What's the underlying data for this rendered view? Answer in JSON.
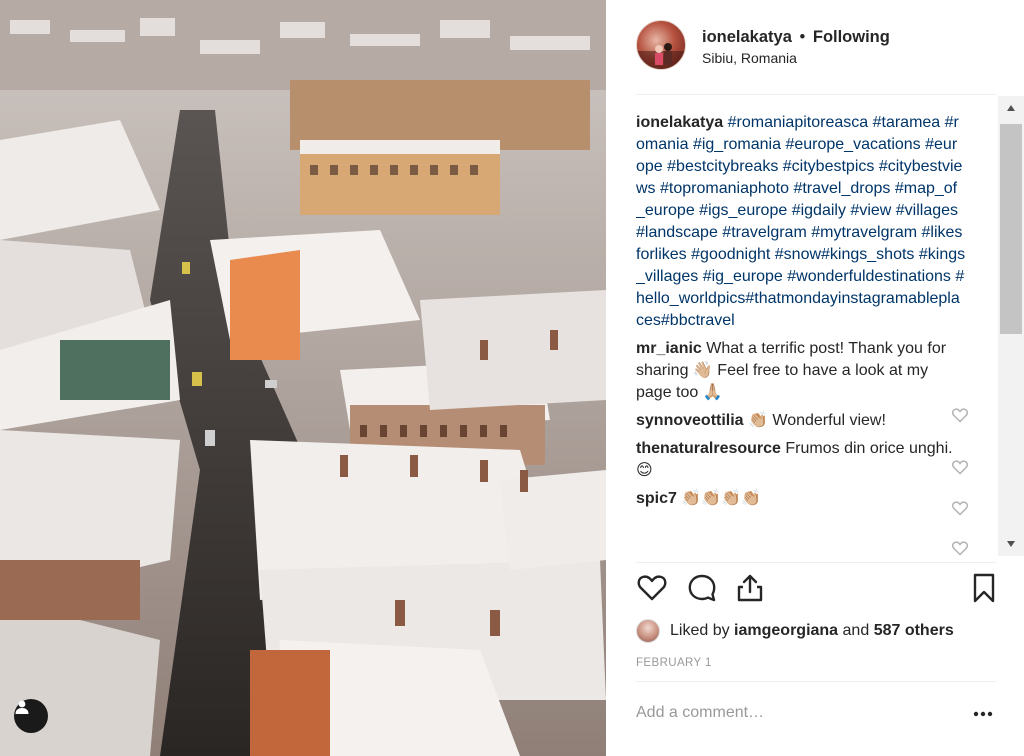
{
  "post": {
    "author": "ionelakatya",
    "separator": "•",
    "follow_status": "Following",
    "location": "Sibiu, Romania",
    "caption_user": "ionelakatya",
    "caption_tags": [
      "#romaniapitoreasca",
      "#taramea",
      "#romania",
      "#ig_romania",
      "#europe_vacations",
      "#europe",
      "#bestcitybreaks",
      "#citybestpics",
      "#citybestviews",
      "#topromaniaphoto",
      "#travel_drops",
      "#map_of_europe",
      "#igs_europe",
      "#igdaily",
      "#view",
      "#villages",
      "#landscape",
      "#travelgram",
      "#mytravelgram",
      "#likesforlikes",
      "#goodnight",
      "#snow#kings_shots",
      "#kings_villages",
      "#ig_europe",
      "#wonderfuldestinations",
      "#hello_worldpics#thatmondayinstagramableplaces#bbctravel"
    ],
    "comments": [
      {
        "user": "mr_ianic",
        "text": "What a terrific post! Thank you for sharing 👋🏼 Feel free to have a look at my page too 🙏🏼"
      },
      {
        "user": "synnoveottilia",
        "text": "👏🏼 Wonderful view!"
      },
      {
        "user": "thenaturalresource",
        "text": "Frumos din orice unghi.😊"
      },
      {
        "user": "spic7",
        "text": "👏🏼👏🏼👏🏼👏🏼"
      }
    ],
    "likes": {
      "prefix": "Liked by",
      "user": "iamgeorgiana",
      "middle": "and",
      "others": "587 others"
    },
    "date": "FEBRUARY 1",
    "add_comment_placeholder": "Add a comment…",
    "more_label": "•••"
  },
  "icons": {
    "like": "heart-icon",
    "comment": "comment-bubble-icon",
    "share": "share-icon",
    "save": "bookmark-icon",
    "user_tag": "user-icon"
  },
  "colors": {
    "hashtag": "#003569",
    "text": "#262626",
    "muted": "#999999"
  }
}
